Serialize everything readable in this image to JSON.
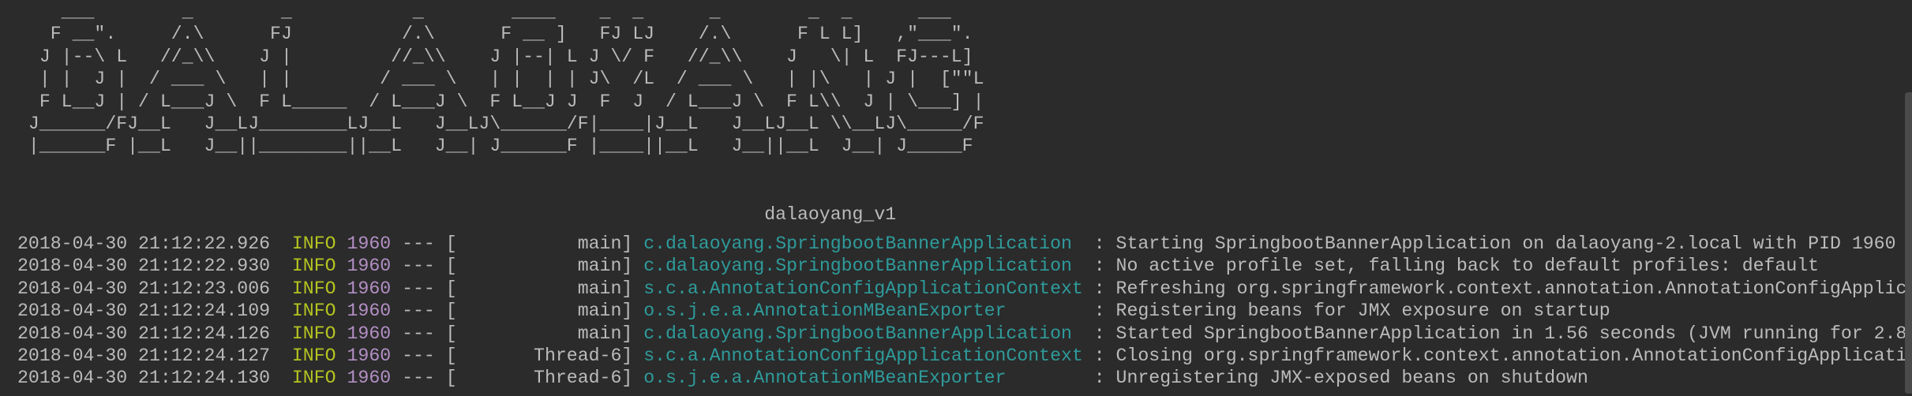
{
  "banner": {
    "lines": [
      "    ___        _        _           _        ____    _  _      _        _  _      ___",
      "   F __\".     /.\\      FJ          /.\\      F __ ]   FJ LJ    /.\\      F L L]   ,\"___\".",
      "  J |--\\ L   //_\\\\    J |         //_\\\\    J |--| L J \\/ F   //_\\\\    J   \\| L  FJ---L]",
      "  | |  J |  / ___ \\   | |        / ___ \\   | |  | | J\\  /L  / ___ \\   | |\\   | J |  [\"\"L",
      "  F L__J | / L___J \\  F L_____  / L___J \\  F L__J J  F  J  / L___J \\  F L\\\\  J | \\___] |",
      " J______/FJ__L   J__LJ________LJ__L   J__LJ\\______/F|____|J__L   J__LJ__L \\\\__LJ\\_____/F",
      " |______F |__L   J__||________||__L   J__| J______F |____||__L   J__||__L  J__| J_____F"
    ],
    "logo_text": "DALAOYANG"
  },
  "version_line": "dalaoyang_v1",
  "logs": [
    {
      "timestamp": "2018-04-30 21:12:22.926",
      "level": "INFO",
      "pid": "1960",
      "sep": "--- [",
      "thread": "main",
      "logger": "c.dalaoyang.SpringbootBannerApplication",
      "message": "Starting SpringbootBannerApplication on dalaoyang-2.local with PID 1960"
    },
    {
      "timestamp": "2018-04-30 21:12:22.930",
      "level": "INFO",
      "pid": "1960",
      "sep": "--- [",
      "thread": "main",
      "logger": "c.dalaoyang.SpringbootBannerApplication",
      "message": "No active profile set, falling back to default profiles: default"
    },
    {
      "timestamp": "2018-04-30 21:12:23.006",
      "level": "INFO",
      "pid": "1960",
      "sep": "--- [",
      "thread": "main",
      "logger": "s.c.a.AnnotationConfigApplicationContext",
      "message": "Refreshing org.springframework.context.annotation.AnnotationConfigApplic"
    },
    {
      "timestamp": "2018-04-30 21:12:24.109",
      "level": "INFO",
      "pid": "1960",
      "sep": "--- [",
      "thread": "main",
      "logger": "o.s.j.e.a.AnnotationMBeanExporter",
      "message": "Registering beans for JMX exposure on startup"
    },
    {
      "timestamp": "2018-04-30 21:12:24.126",
      "level": "INFO",
      "pid": "1960",
      "sep": "--- [",
      "thread": "main",
      "logger": "c.dalaoyang.SpringbootBannerApplication",
      "message": "Started SpringbootBannerApplication in 1.56 seconds (JVM running for 2.8"
    },
    {
      "timestamp": "2018-04-30 21:12:24.127",
      "level": "INFO",
      "pid": "1960",
      "sep": "--- [",
      "thread": "Thread-6",
      "logger": "s.c.a.AnnotationConfigApplicationContext",
      "message": "Closing org.springframework.context.annotation.AnnotationConfigApplicati"
    },
    {
      "timestamp": "2018-04-30 21:12:24.130",
      "level": "INFO",
      "pid": "1960",
      "sep": "--- [",
      "thread": "Thread-6",
      "logger": "o.s.j.e.a.AnnotationMBeanExporter",
      "message": "Unregistering JMX-exposed beans on shutdown"
    }
  ],
  "colors": {
    "background": "#2b2b2b",
    "text": "#bbbbbb",
    "level_info": "#b5c420",
    "pid": "#b38fc4",
    "logger": "#2f9b9b"
  }
}
